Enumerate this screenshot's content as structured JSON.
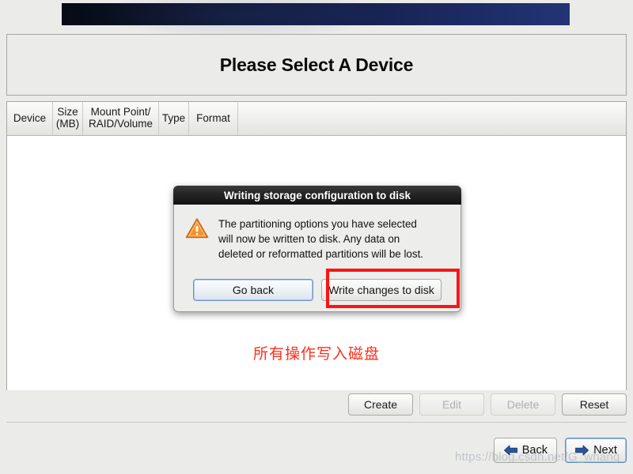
{
  "banner": {
    "name": "anaconda-banner"
  },
  "header": {
    "title": "Please Select A Device"
  },
  "device_table": {
    "columns": [
      {
        "id": "device",
        "label": "Device"
      },
      {
        "id": "size",
        "label": "Size\n(MB)"
      },
      {
        "id": "mount",
        "label": "Mount Point/\nRAID/Volume"
      },
      {
        "id": "type",
        "label": "Type"
      },
      {
        "id": "format",
        "label": "Format"
      }
    ],
    "rows": []
  },
  "annotation": {
    "chinese_note": "所有操作写入磁盘",
    "note_color": "#ff2d18",
    "highlight_color": "#fb1414"
  },
  "actions": {
    "create_label": "Create",
    "edit_label": "Edit",
    "delete_label": "Delete",
    "reset_label": "Reset",
    "edit_disabled": true,
    "delete_disabled": true
  },
  "navigation": {
    "back_label": "Back",
    "next_label": "Next",
    "arrow_color": "#2a5699"
  },
  "dialog": {
    "title": "Writing storage configuration to disk",
    "message": "The partitioning options you have selected\nwill now be written to disk.  Any data on\ndeleted or reformatted partitions will be lost.",
    "icon": "warning-triangle-icon",
    "go_back_label": "Go back",
    "write_changes_label": "Write changes to disk"
  },
  "watermark": {
    "text": "https://blog.csdn.net/G_whang"
  }
}
